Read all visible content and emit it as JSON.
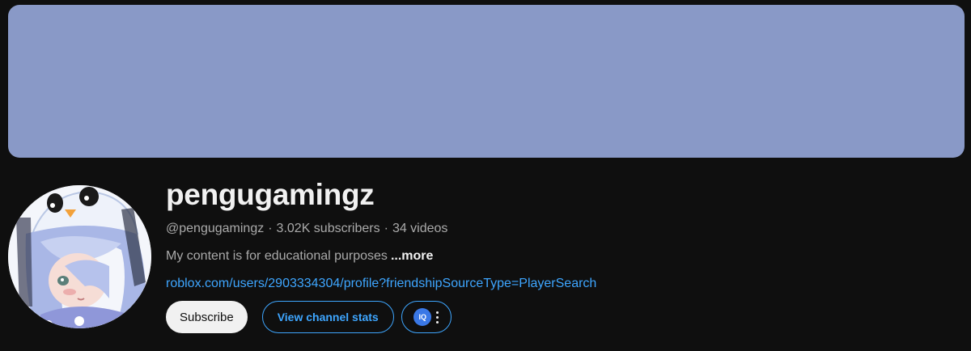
{
  "banner": {
    "color": "#8999c7"
  },
  "channel": {
    "name": "pengugamingz",
    "handle": "@pengugamingz",
    "subscribers": "3.02K subscribers",
    "videos": "34 videos",
    "separator": "·",
    "description": "My content is for educational purposes",
    "more_label": "...more",
    "link": "roblox.com/users/2903334304/profile?friendshipSourceType=PlayerSearch"
  },
  "actions": {
    "subscribe_label": "Subscribe",
    "stats_label": "View channel stats",
    "extension_logo_text": "IQ",
    "extension_icon": "extension-logo-icon",
    "more_icon": "more-vert-icon"
  },
  "colors": {
    "background": "#0f0f0f",
    "accent": "#3ea6ff",
    "primary_text": "#f1f1f1",
    "secondary_text": "#aaaaaa"
  }
}
